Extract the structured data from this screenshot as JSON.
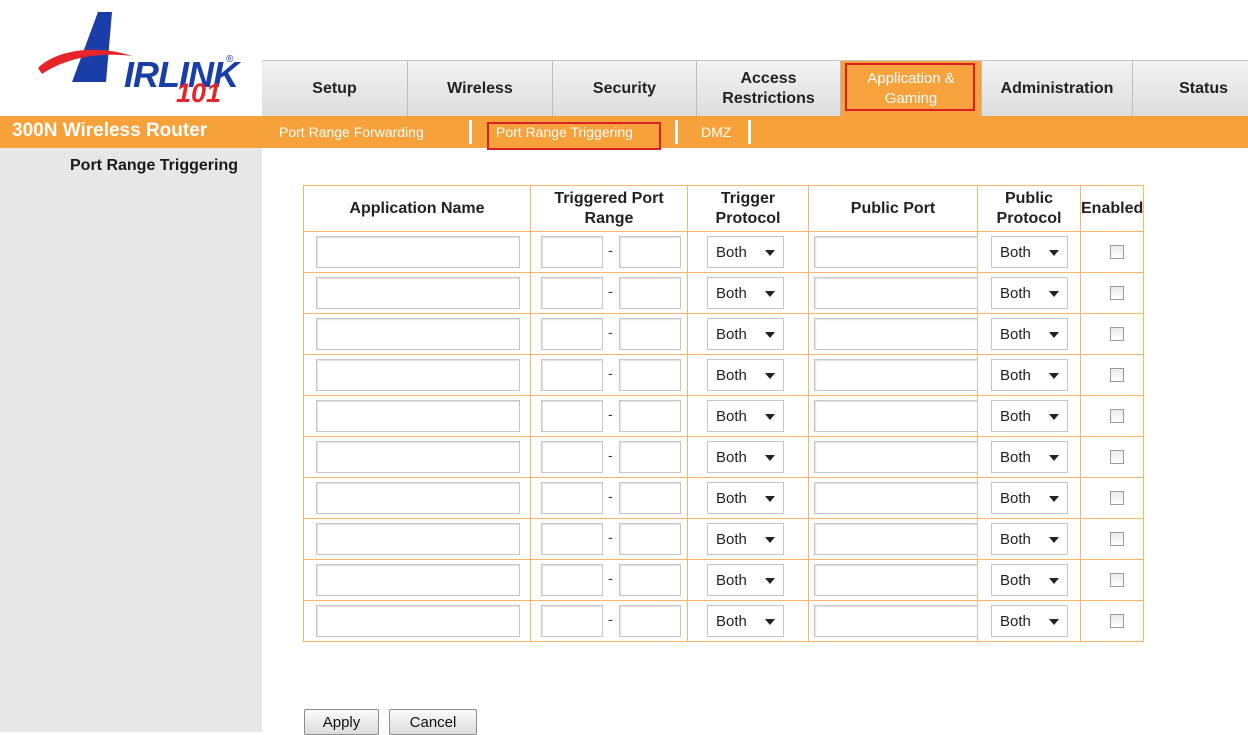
{
  "brand": {
    "logo_word": "IRLINK",
    "logo_num": "101",
    "product": "300N Wireless Router"
  },
  "tabs": [
    {
      "label": "Setup"
    },
    {
      "label": "Wireless"
    },
    {
      "label": "Security"
    },
    {
      "label": "Access Restrictions"
    },
    {
      "label": "Application & Gaming"
    },
    {
      "label": "Administration"
    },
    {
      "label": "Status"
    }
  ],
  "subnav": [
    {
      "label": "Port Range Forwarding"
    },
    {
      "label": "Port Range Triggering"
    },
    {
      "label": "DMZ"
    }
  ],
  "section_title": "Port Range Triggering",
  "table": {
    "headers": {
      "app_name": "Application Name",
      "trig_range": "Triggered Port Range",
      "trig_proto": "Trigger Protocol",
      "public_port": "Public Port",
      "public_proto": "Public Protocol",
      "enabled": "Enabled"
    },
    "dash": "-",
    "rows": [
      {
        "trigger_protocol": "Both",
        "public_protocol": "Both"
      },
      {
        "trigger_protocol": "Both",
        "public_protocol": "Both"
      },
      {
        "trigger_protocol": "Both",
        "public_protocol": "Both"
      },
      {
        "trigger_protocol": "Both",
        "public_protocol": "Both"
      },
      {
        "trigger_protocol": "Both",
        "public_protocol": "Both"
      },
      {
        "trigger_protocol": "Both",
        "public_protocol": "Both"
      },
      {
        "trigger_protocol": "Both",
        "public_protocol": "Both"
      },
      {
        "trigger_protocol": "Both",
        "public_protocol": "Both"
      },
      {
        "trigger_protocol": "Both",
        "public_protocol": "Both"
      },
      {
        "trigger_protocol": "Both",
        "public_protocol": "Both"
      }
    ]
  },
  "buttons": {
    "apply": "Apply",
    "cancel": "Cancel"
  },
  "colors": {
    "accent_orange": "#f7a13a",
    "highlight_red": "#d81f26",
    "logo_blue": "#1a3ea8",
    "logo_red": "#e8242b"
  }
}
